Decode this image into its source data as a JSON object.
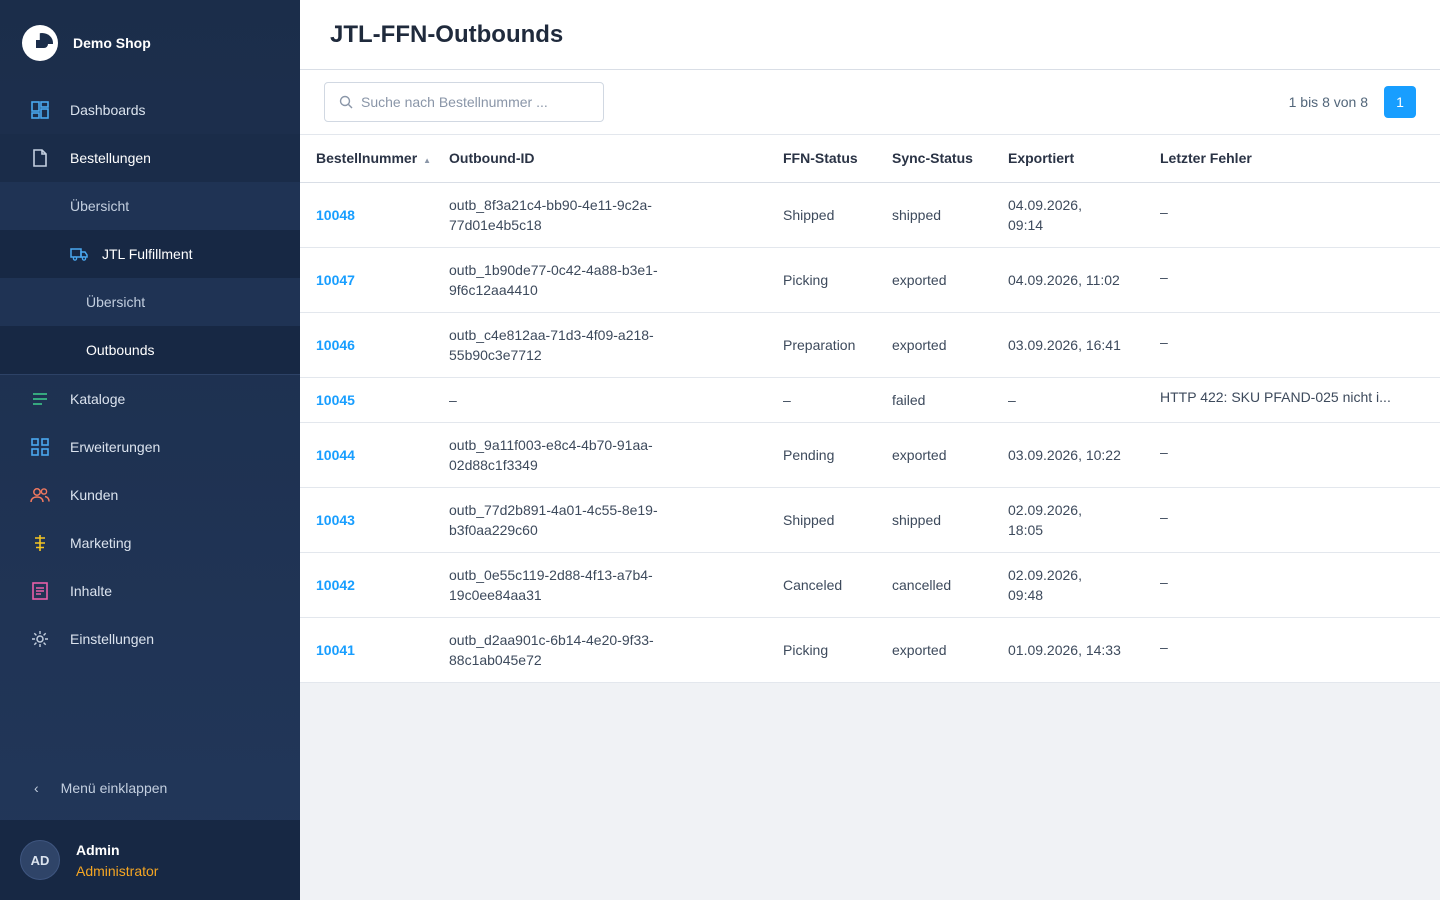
{
  "brand": {
    "name": "Demo Shop"
  },
  "nav": {
    "dashboards": "Dashboards",
    "bestellungen": "Bestellungen",
    "uebersicht": "Übersicht",
    "jtl": "JTL Fulfillment",
    "jtl_uebersicht": "Übersicht",
    "outbounds": "Outbounds",
    "kataloge": "Kataloge",
    "erweiterungen": "Erweiterungen",
    "kunden": "Kunden",
    "marketing": "Marketing",
    "inhalte": "Inhalte",
    "einstellungen": "Einstellungen",
    "collapse": "Menü einklappen"
  },
  "user": {
    "initials": "AD",
    "name": "Admin",
    "role": "Administrator"
  },
  "page": {
    "title": "JTL-FFN-Outbounds"
  },
  "search": {
    "placeholder": "Suche nach Bestellnummer ..."
  },
  "pager": {
    "text": "1 bis 8 von 8",
    "current": "1"
  },
  "table": {
    "headers": [
      "Bestellnummer",
      "Outbound-ID",
      "FFN-Status",
      "Sync-Status",
      "Exportiert",
      "Letzter Fehler"
    ],
    "rows": [
      {
        "order": "10048",
        "outbound": "outb_8f3a21c4-bb90-4e11-9c2a-77d01e4b5c18",
        "ffn": "Shipped",
        "sync": "shipped",
        "exported": "04.09.2026, 09:14",
        "error": "–"
      },
      {
        "order": "10047",
        "outbound": "outb_1b90de77-0c42-4a88-b3e1-9f6c12aa4410",
        "ffn": "Picking",
        "sync": "exported",
        "exported": "04.09.2026, 11:02",
        "error": "–"
      },
      {
        "order": "10046",
        "outbound": "outb_c4e812aa-71d3-4f09-a218-55b90c3e7712",
        "ffn": "Preparation",
        "sync": "exported",
        "exported": "03.09.2026, 16:41",
        "error": "–"
      },
      {
        "order": "10045",
        "outbound": "–",
        "ffn": "–",
        "sync": "failed",
        "exported": "–",
        "error": "HTTP 422: SKU PFAND-025 nicht i..."
      },
      {
        "order": "10044",
        "outbound": "outb_9a11f003-e8c4-4b70-91aa-02d88c1f3349",
        "ffn": "Pending",
        "sync": "exported",
        "exported": "03.09.2026, 10:22",
        "error": "–"
      },
      {
        "order": "10043",
        "outbound": "outb_77d2b891-4a01-4c55-8e19-b3f0aa229c60",
        "ffn": "Shipped",
        "sync": "shipped",
        "exported": "02.09.2026, 18:05",
        "error": "–"
      },
      {
        "order": "10042",
        "outbound": "outb_0e55c119-2d88-4f13-a7b4-19c0ee84aa31",
        "ffn": "Canceled",
        "sync": "cancelled",
        "exported": "02.09.2026, 09:48",
        "error": "–"
      },
      {
        "order": "10041",
        "outbound": "outb_d2aa901c-6b14-4e20-9f33-88c1ab045e72",
        "ffn": "Picking",
        "sync": "exported",
        "exported": "01.09.2026, 14:33",
        "error": "–"
      }
    ]
  },
  "colors": {
    "accent": "#189eff",
    "sidebar": "#1b2d4a",
    "role": "#f5a623"
  }
}
